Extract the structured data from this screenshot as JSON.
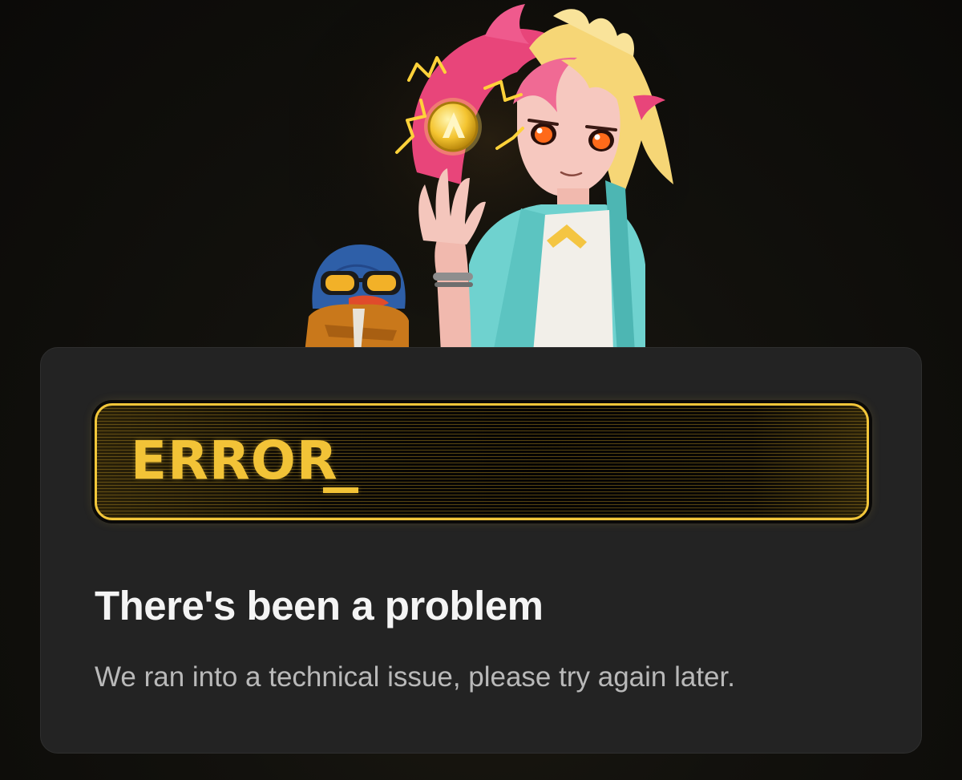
{
  "error_panel": {
    "label": "ERROR"
  },
  "message": {
    "title": "There's been a problem",
    "body": "We ran into a technical issue, please try again later."
  },
  "illustration": {
    "characters": [
      "penguin-mascot",
      "pink-haired-girl"
    ],
    "coin_icon": "coin-icon"
  },
  "colors": {
    "accent": "#f2c337",
    "card_background": "#232323",
    "page_background": "#0e0d0b",
    "title_text": "#f4f4f4",
    "body_text": "#b9b9b9"
  }
}
